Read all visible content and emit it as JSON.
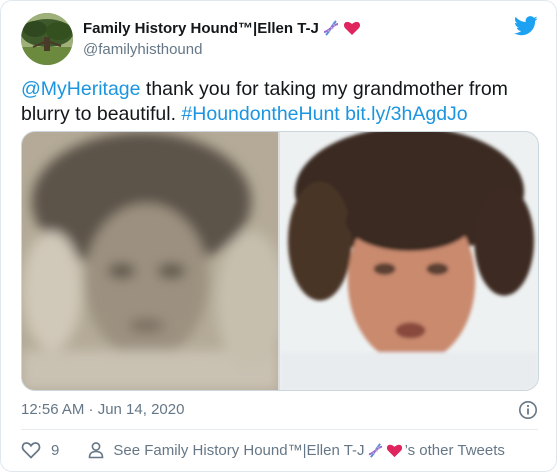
{
  "tweet": {
    "display_name": "Family History Hound™|Ellen T-J",
    "handle": "@familyhisthound",
    "text_mention": "@MyHeritage",
    "text_body": " thank you for taking my grandmother from blurry to beautiful. ",
    "text_hashtag": "#HoundontheHunt",
    "text_link": "bit.ly/3hAgdJo",
    "timestamp": "12:56 AM · Jun 14, 2020",
    "like_count": "9",
    "other_tweets_prefix": "See Family History Hound™|Ellen T-J",
    "other_tweets_suffix": "’s other Tweets"
  },
  "colors": {
    "link": "#1b95e0",
    "muted": "#657786",
    "text": "#14171a",
    "heart": "#e0245e",
    "twitter_blue": "#1da1f2"
  },
  "icons": {
    "brand": "twitter-bird-icon",
    "dna": "dna-emoji",
    "heart": "red-heart-emoji",
    "info": "info-icon",
    "like": "heart-outline-icon",
    "profile": "person-icon"
  }
}
